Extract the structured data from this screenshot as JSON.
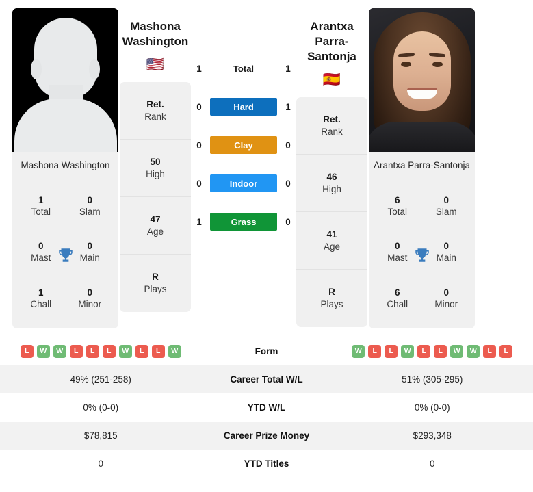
{
  "players": {
    "left": {
      "name": "Mashona Washington",
      "name_line1": "Mashona",
      "name_line2": "Washington",
      "flag": "🇺🇸",
      "photo_caption": "Mashona Washington",
      "photo_type": "silhouette-placeholder",
      "titles": {
        "total": "1",
        "total_label": "Total",
        "slam": "0",
        "slam_label": "Slam",
        "mast": "0",
        "mast_label": "Mast",
        "main": "0",
        "main_label": "Main",
        "chall": "1",
        "chall_label": "Chall",
        "minor": "0",
        "minor_label": "Minor"
      },
      "stats": [
        {
          "value": "Ret.",
          "label": "Rank"
        },
        {
          "value": "50",
          "label": "High"
        },
        {
          "value": "47",
          "label": "Age"
        },
        {
          "value": "R",
          "label": "Plays"
        }
      ],
      "form": [
        "L",
        "W",
        "W",
        "L",
        "L",
        "L",
        "W",
        "L",
        "L",
        "W"
      ],
      "career_total_wl": "49% (251-258)",
      "ytd_wl": "0% (0-0)",
      "career_prize_money": "$78,815",
      "ytd_titles": "0"
    },
    "right": {
      "name": "Arantxa Parra-Santonja",
      "name_line1": "Arantxa Parra-",
      "name_line2": "Santonja",
      "flag": "🇪🇸",
      "photo_caption": "Arantxa Parra-Santonja",
      "photo_type": "portrait-photo",
      "titles": {
        "total": "6",
        "total_label": "Total",
        "slam": "0",
        "slam_label": "Slam",
        "mast": "0",
        "mast_label": "Mast",
        "main": "0",
        "main_label": "Main",
        "chall": "6",
        "chall_label": "Chall",
        "minor": "0",
        "minor_label": "Minor"
      },
      "stats": [
        {
          "value": "Ret.",
          "label": "Rank"
        },
        {
          "value": "46",
          "label": "High"
        },
        {
          "value": "41",
          "label": "Age"
        },
        {
          "value": "R",
          "label": "Plays"
        }
      ],
      "form": [
        "W",
        "L",
        "L",
        "W",
        "L",
        "L",
        "W",
        "W",
        "L",
        "L"
      ],
      "career_total_wl": "51% (305-295)",
      "ytd_wl": "0% (0-0)",
      "career_prize_money": "$293,348",
      "ytd_titles": "0"
    }
  },
  "surfaces": [
    {
      "label": "Total",
      "left": "1",
      "right": "1",
      "color": "transparent",
      "has_bar": false
    },
    {
      "label": "Hard",
      "left": "0",
      "right": "1",
      "color": "#0d6fbd",
      "has_bar": true
    },
    {
      "label": "Clay",
      "left": "0",
      "right": "0",
      "color": "#e09213",
      "has_bar": true
    },
    {
      "label": "Indoor",
      "left": "0",
      "right": "0",
      "color": "#2196f3",
      "has_bar": true
    },
    {
      "label": "Grass",
      "left": "1",
      "right": "0",
      "color": "#109537",
      "has_bar": true
    }
  ],
  "table_rows": [
    {
      "label": "Form",
      "left": "",
      "right": "",
      "type": "form",
      "shaded": false
    },
    {
      "label": "Career Total W/L",
      "left": "49% (251-258)",
      "right": "51% (305-295)",
      "type": "text",
      "shaded": true
    },
    {
      "label": "YTD W/L",
      "left": "0% (0-0)",
      "right": "0% (0-0)",
      "type": "text",
      "shaded": false
    },
    {
      "label": "Career Prize Money",
      "left": "$78,815",
      "right": "$293,348",
      "type": "text",
      "shaded": true
    },
    {
      "label": "YTD Titles",
      "left": "0",
      "right": "0",
      "type": "text",
      "shaded": false
    }
  ],
  "colors": {
    "win_badge": "#6fbb74",
    "loss_badge": "#ec5b4f",
    "trophy": "#3a7cbe",
    "card_bg": "#f0f0f0",
    "row_shade": "#f2f2f2"
  },
  "icons": {
    "trophy": "trophy-icon"
  }
}
